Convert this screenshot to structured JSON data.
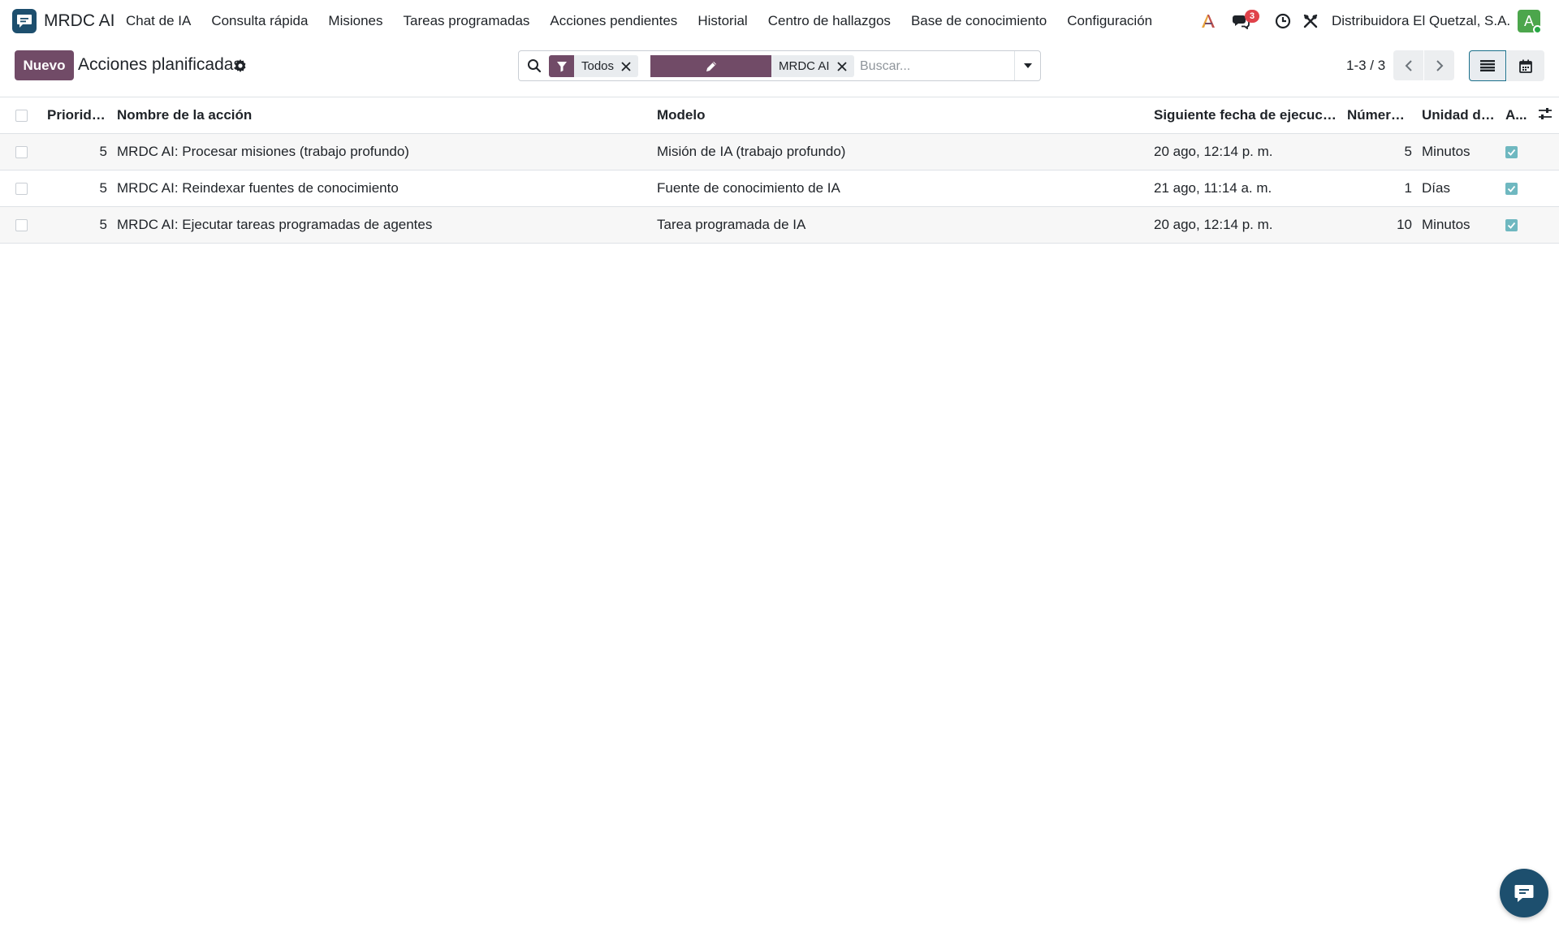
{
  "app": {
    "name": "MRDC AI"
  },
  "menu": [
    "Chat de IA",
    "Consulta rápida",
    "Misiones",
    "Tareas programadas",
    "Acciones pendientes",
    "Historial",
    "Centro de hallazgos",
    "Base de conocimiento",
    "Configuración"
  ],
  "navbar": {
    "messages_count": "3",
    "company": "Distribuidora El Quetzal, S.A.",
    "avatar_letter": "A"
  },
  "control_panel": {
    "new_button": "Nuevo",
    "title": "Acciones planificadas",
    "search": {
      "facets": [
        {
          "label": "Todos"
        },
        {
          "label": "MRDC AI"
        }
      ],
      "placeholder": "Buscar..."
    },
    "pager": "1-3 / 3"
  },
  "table": {
    "headers": {
      "priority": "Prioridad",
      "name": "Nombre de la acción",
      "model": "Modelo",
      "next_run": "Siguiente fecha de ejecución",
      "number": "Número ...",
      "unit": "Unidad de...",
      "active": "A..."
    },
    "rows": [
      {
        "priority": "5",
        "name": "MRDC AI: Procesar misiones (trabajo profundo)",
        "model": "Misión de IA (trabajo profundo)",
        "next_run": "20 ago, 12:14 p. m.",
        "number": "5",
        "unit": "Minutos",
        "active": true
      },
      {
        "priority": "5",
        "name": "MRDC AI: Reindexar fuentes de conocimiento",
        "model": "Fuente de conocimiento de IA",
        "next_run": "21 ago, 11:14 a. m.",
        "number": "1",
        "unit": "Días",
        "active": true
      },
      {
        "priority": "5",
        "name": "MRDC AI: Ejecutar tareas programadas de agentes",
        "model": "Tarea programada de IA",
        "next_run": "20 ago, 12:14 p. m.",
        "number": "10",
        "unit": "Minutos",
        "active": true
      }
    ]
  },
  "colors": {
    "brand": "#714b67",
    "logo": "#1d4f6e",
    "active_check": "#6fb8c0",
    "badge": "#e0424a"
  }
}
